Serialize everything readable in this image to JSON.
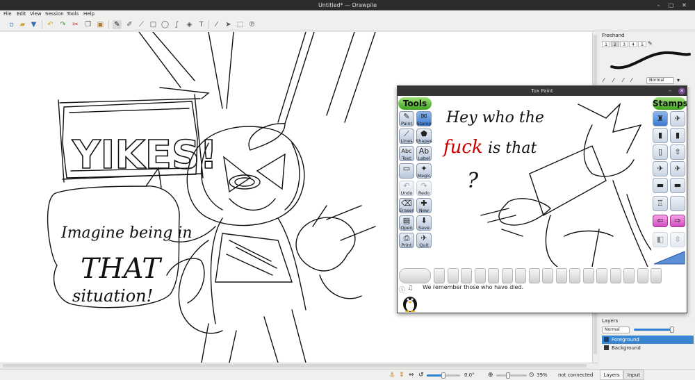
{
  "window": {
    "title": "Untitled* — Drawpile",
    "controls": [
      "–",
      "□",
      "✕"
    ]
  },
  "menu": [
    "File",
    "Edit",
    "View",
    "Session",
    "Tools",
    "Help"
  ],
  "toolbar": {
    "icons": [
      "new-icon",
      "open-icon",
      "save-icon",
      "undo-icon",
      "redo-icon",
      "cut-icon",
      "copy-icon",
      "paste-icon",
      "brush-icon",
      "eraser-icon",
      "line-icon",
      "rectangle-icon",
      "ellipse-icon",
      "bezier-icon",
      "fill-icon",
      "text-icon",
      "color-picker-icon",
      "select-icon",
      "rect-select-icon",
      "lasso-icon"
    ]
  },
  "canvas_art": {
    "yikes": "YIKES!",
    "bubble_line1": "Imagine being in",
    "bubble_line2": "THAT",
    "bubble_line3": "situation!"
  },
  "status": {
    "angle": "0.0°",
    "zoom": "39%",
    "connection": "not connected",
    "zoom_fraction": 0.39,
    "rotate_fraction": 0.5
  },
  "dock": {
    "freehand_title": "Freehand",
    "brush_slots": [
      "1",
      "2",
      "3",
      "4",
      "5"
    ],
    "blend_mode": "Normal",
    "layers_title": "Layers",
    "layers_blend": "Normal",
    "opacity_fraction": 0.98,
    "layers": [
      {
        "name": "Foreground",
        "selected": true
      },
      {
        "name": "Background",
        "selected": false
      }
    ],
    "tabs": [
      "Layers",
      "Input"
    ]
  },
  "tuxpaint": {
    "title": "Tux Paint",
    "tools_header": "Tools",
    "stamps_header": "Stamps",
    "tools": [
      {
        "label": "Paint",
        "glyph": "✎",
        "selected": false
      },
      {
        "label": "Stamp",
        "glyph": "✉",
        "selected": true
      },
      {
        "label": "Lines",
        "glyph": "⟋",
        "selected": false
      },
      {
        "label": "Shapes",
        "glyph": "⬟",
        "selected": false
      },
      {
        "label": "Text",
        "glyph": "Abc",
        "selected": false
      },
      {
        "label": "Label",
        "glyph": "Ab",
        "selected": false
      },
      {
        "label": "",
        "glyph": "▭",
        "selected": false
      },
      {
        "label": "Magic",
        "glyph": "✦",
        "selected": false
      },
      {
        "label": "Undo",
        "glyph": "↶",
        "selected": false,
        "disabled": true
      },
      {
        "label": "Redo",
        "glyph": "↷",
        "selected": false,
        "disabled": true
      },
      {
        "label": "Eraser",
        "glyph": "⌫",
        "selected": false
      },
      {
        "label": "New",
        "glyph": "✚",
        "selected": false
      },
      {
        "label": "Open",
        "glyph": "▤",
        "selected": false
      },
      {
        "label": "Save",
        "glyph": "⬇",
        "selected": false
      },
      {
        "label": "Print",
        "glyph": "⎙",
        "selected": false
      },
      {
        "label": "Quit",
        "glyph": "✈",
        "selected": false
      }
    ],
    "message": "We remember those who have died.",
    "canvas_text": {
      "line1": "Hey who the",
      "red_word": "fuck",
      "line2": "is that",
      "question": "?"
    }
  }
}
